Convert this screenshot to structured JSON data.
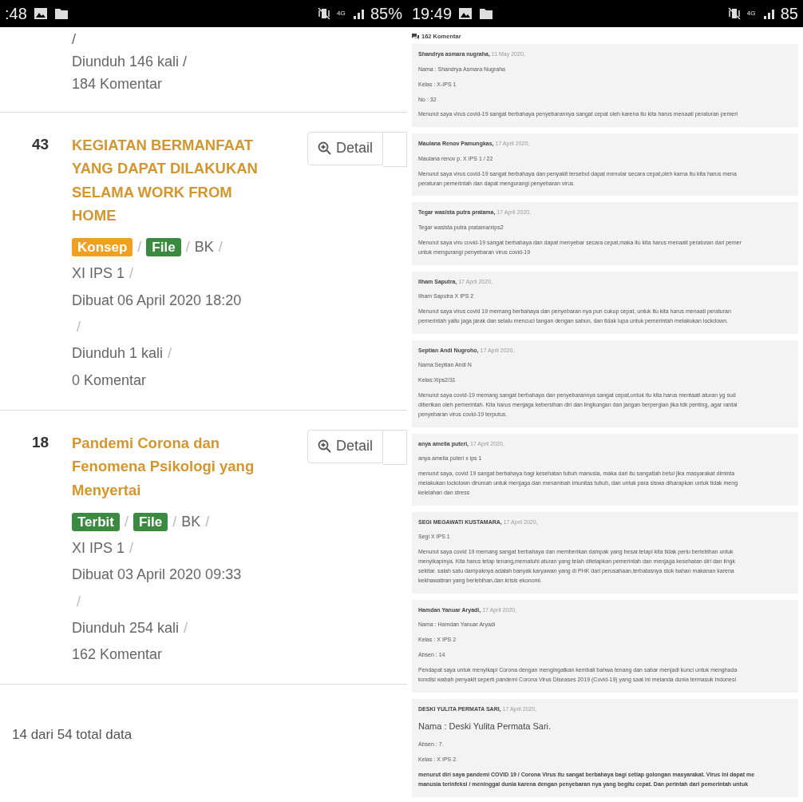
{
  "left_screen": {
    "status_bar": {
      "time": ":48",
      "network": "4G",
      "battery": "85%"
    },
    "partial_item": {
      "lines": [
        "/",
        "Diunduh 146 kali /",
        "184 Komentar"
      ]
    },
    "items": [
      {
        "number": "43",
        "title": "KEGIATAN BERMANFAAT YANG DAPAT DILAKUKAN SELAMA WORK FROM HOME",
        "detail_button": "Detail",
        "meta_lines": [
          [
            {
              "kind": "draft",
              "text": "Konsep"
            },
            {
              "kind": "sep",
              "text": "/"
            },
            {
              "kind": "file",
              "text": "File"
            },
            {
              "kind": "sep",
              "text": "/"
            },
            {
              "kind": "text",
              "text": "BK"
            },
            {
              "kind": "sep",
              "text": "/"
            }
          ],
          [
            {
              "kind": "text",
              "text": "XI IPS 1"
            },
            {
              "kind": "sep",
              "text": "/"
            }
          ],
          [
            {
              "kind": "text",
              "text": "Dibuat 06 April 2020 18:20"
            }
          ],
          [
            {
              "kind": "sep",
              "text": "/"
            }
          ],
          [
            {
              "kind": "text",
              "text": "Diunduh 1 kali"
            },
            {
              "kind": "sep",
              "text": "/"
            }
          ],
          [
            {
              "kind": "text",
              "text": "0 Komentar"
            }
          ]
        ]
      },
      {
        "number": "18",
        "title": "Pandemi Corona dan Fenomena Psikologi yang Menyertai",
        "detail_button": "Detail",
        "meta_lines": [
          [
            {
              "kind": "published",
              "text": "Terbit"
            },
            {
              "kind": "sep",
              "text": "/"
            },
            {
              "kind": "file",
              "text": "File"
            },
            {
              "kind": "sep",
              "text": "/"
            },
            {
              "kind": "text",
              "text": "BK"
            },
            {
              "kind": "sep",
              "text": "/"
            }
          ],
          [
            {
              "kind": "text",
              "text": "XI IPS 1"
            },
            {
              "kind": "sep",
              "text": "/"
            }
          ],
          [
            {
              "kind": "text",
              "text": "Dibuat 03 April 2020 09:33"
            }
          ],
          [
            {
              "kind": "sep",
              "text": "/"
            }
          ],
          [
            {
              "kind": "text",
              "text": "Diunduh 254 kali"
            },
            {
              "kind": "sep",
              "text": "/"
            }
          ],
          [
            {
              "kind": "text",
              "text": "162 Komentar"
            }
          ]
        ]
      }
    ],
    "footer": "14 dari 54 total data"
  },
  "right_screen": {
    "status_bar": {
      "time": "19:49",
      "network": "4G",
      "battery": "85"
    },
    "comment_count": "162 Komentar",
    "comments": [
      {
        "author": "Shandrya asmara nugraha,",
        "date": "11 May 2020,",
        "paragraphs": [
          {
            "kind": "normal",
            "lines": [
              "Nama : Shandrya Asmara Nugraha"
            ]
          },
          {
            "kind": "normal",
            "lines": [
              "Kelas : X-IPS 1"
            ]
          },
          {
            "kind": "normal",
            "lines": [
              "No : 32"
            ]
          },
          {
            "kind": "normal",
            "lines": [
              "Menurut saya virus covid-19 sangat berbahaya penyebarannya sangat cepat oleh karena itu kita harus menaati peraturan pemeri"
            ]
          }
        ]
      },
      {
        "author": "Maulana Renov Pamungkas,",
        "date": "17 April 2020,",
        "paragraphs": [
          {
            "kind": "normal",
            "lines": [
              "Maulana renov p. X IPS 1 / 22"
            ]
          },
          {
            "kind": "normal",
            "lines": [
              "Menurut saya virus covid-19 sangat berbahaya dan penyakit tersebut dapat menular secara cepat,oleh karna itu kita harus mena",
              "peraturan pemerintah dan dapat mengurangi penyebaran virus"
            ]
          }
        ]
      },
      {
        "author": "Tegar wasista putra pratama,",
        "date": "17 April 2020,",
        "paragraphs": [
          {
            "kind": "normal",
            "lines": [
              "Tegar wasista putra pratama/xips2"
            ]
          },
          {
            "kind": "normal",
            "lines": [
              "Menurut saya viru covid-19 sangat berbahaya dan dapat menyebar secara cepat,maka itu kita harus menaati peraturan dari pemer",
              "untuk mengurangi penyebaran virus covid-19"
            ]
          }
        ]
      },
      {
        "author": "Ilham Saputra,",
        "date": "17 April 2020,",
        "paragraphs": [
          {
            "kind": "normal",
            "lines": [
              "Ilham Saputra X IPS 2"
            ]
          },
          {
            "kind": "normal",
            "lines": [
              "Menurut saya virus covid 19 memang berbahaya dan penyebaran nya pun cukup cepat, untuk itu kita harus menaati peraturan",
              "pemerintah yaitu jaga jarak dan selalu mencuci tangan dengan sabun, dan tidak lupa untuk pemerintah melakukan lockdown."
            ]
          }
        ]
      },
      {
        "author": "Septian Andi Nugroho,",
        "date": "17 April 2020,",
        "paragraphs": [
          {
            "kind": "normal",
            "lines": [
              "Nama:Septian Andi N"
            ]
          },
          {
            "kind": "normal",
            "lines": [
              "Kelas:Xips2/31"
            ]
          },
          {
            "kind": "normal",
            "lines": [
              "Menurut saya covid-19 memang sangat berbahaya dan penyebarannya sangat cepat,untuk itu kita harus mentaati aturan yg sud",
              "diberikan oleh pemerintah. Kita harus menjaga kebersihan diri dan lingkungan dan jangan berpergian jika tdk penting, agar rantai",
              "penyebaran virus covid-19 terputus."
            ]
          }
        ]
      },
      {
        "author": "anya amelia puteri,",
        "date": "17 April 2020,",
        "paragraphs": [
          {
            "kind": "normal",
            "lines": [
              "anya amelia puteri x ips 1"
            ]
          },
          {
            "kind": "normal",
            "lines": [
              "menurut saya, covid 19 sangat berbahaya bagi kesehatan tubuh manusia, maka dari itu sangatlah betul jika masyarakat diminta",
              "melakukan lockdown dirumah untuk menjaga dan menambah imunitas tubuh, dan untuk para siswa diharapkan untuk tidak meng",
              "kelelahan dan stress"
            ]
          }
        ]
      },
      {
        "author": "SEGI MEGAWATI KUSTAMARA,",
        "date": "17 April 2020,",
        "paragraphs": [
          {
            "kind": "normal",
            "lines": [
              "Segi X IPS 1"
            ]
          },
          {
            "kind": "normal",
            "lines": [
              "Menurut saya covid 19 memang sangat berbahaya dan memberikan dampak yang besar.tetapi kita tidak perlu berlebihan untuk",
              "menyikapinya. Kita harus tetap tenang,mematuhi aturan yang telah ditetapkan pemerintah dan menjaga kesehatan diri dan lingk",
              "sekitar. salah satu dampaknya adalah banyak karyawan yang di PHK dari perusahaan,terbatasnya stok bahan makanan karena",
              "kekhawatiran yang berlebihan,dan krisis ekonomi."
            ]
          }
        ]
      },
      {
        "author": "Hamdan Yanuar Aryadi,",
        "date": "17 April 2020,",
        "paragraphs": [
          {
            "kind": "normal",
            "lines": [
              "Nama : Hamdan Yanuar Aryadi"
            ]
          },
          {
            "kind": "normal",
            "lines": [
              "Kelas : X IPS 2"
            ]
          },
          {
            "kind": "normal",
            "lines": [
              "Absen : 14"
            ]
          },
          {
            "kind": "normal",
            "lines": [
              "Pendapat saya untuk menyikapi Corona dengan mengingatkan kembali bahwa tenang dan sabar menjadi kunci untuk menghada",
              "kondisi wabah penyakit seperti pandemi Corona Virus Diseases 2019 (Covid-19) yang saat ini melanda dunia termasuk Indonesi"
            ]
          }
        ]
      },
      {
        "author": "DESKI YULITA PERMATA SARI,",
        "date": "17 April 2020,",
        "paragraphs": [
          {
            "kind": "large",
            "lines": [
              "Nama : Deski Yulita Permata Sari."
            ]
          },
          {
            "kind": "normal",
            "lines": [
              "Absen : 7."
            ]
          },
          {
            "kind": "normal",
            "lines": [
              "Kelas : X IPS 2."
            ]
          },
          {
            "kind": "strong",
            "lines": [
              "menurut diri saya pandemi COVID 19 / Corona Virus itu sangat berbahaya bagi setiap golongan masyarakat. Virus ini dapat me",
              "manusia terinfeksi / meninggal dunia karena dengan penyebaran nya yang begitu cepat. Dan perintah dari pemerintah untuk"
            ]
          }
        ]
      }
    ]
  }
}
